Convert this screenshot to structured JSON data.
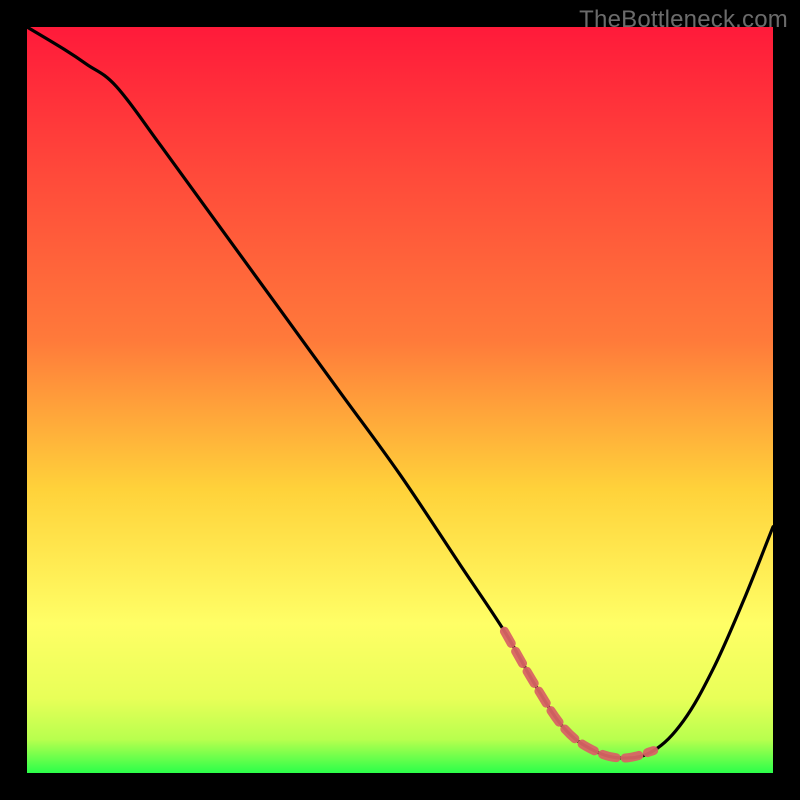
{
  "watermark": "TheBottleneck.com",
  "colors": {
    "page_bg": "#000000",
    "gradient_top": "#ff1a3a",
    "gradient_mid1": "#ff7a3a",
    "gradient_mid2": "#ffd23a",
    "gradient_mid3": "#ffff66",
    "gradient_bottom": "#2bff4a",
    "curve": "#000000",
    "highlight": "#d86464"
  },
  "chart_data": {
    "type": "line",
    "title": "",
    "xlabel": "",
    "ylabel": "",
    "xlim": [
      0,
      100
    ],
    "ylim": [
      0,
      100
    ],
    "series": [
      {
        "name": "bottleneck-curve",
        "x": [
          0,
          5,
          8,
          12,
          18,
          26,
          34,
          42,
          50,
          58,
          64,
          68,
          72,
          76,
          80,
          84,
          88,
          92,
          96,
          100
        ],
        "y": [
          100,
          97,
          95,
          92,
          84,
          73,
          62,
          51,
          40,
          28,
          19,
          12,
          6,
          3,
          2,
          3,
          7,
          14,
          23,
          33
        ]
      }
    ],
    "highlight_range": {
      "x_start": 64,
      "x_end": 85
    },
    "annotations": []
  }
}
